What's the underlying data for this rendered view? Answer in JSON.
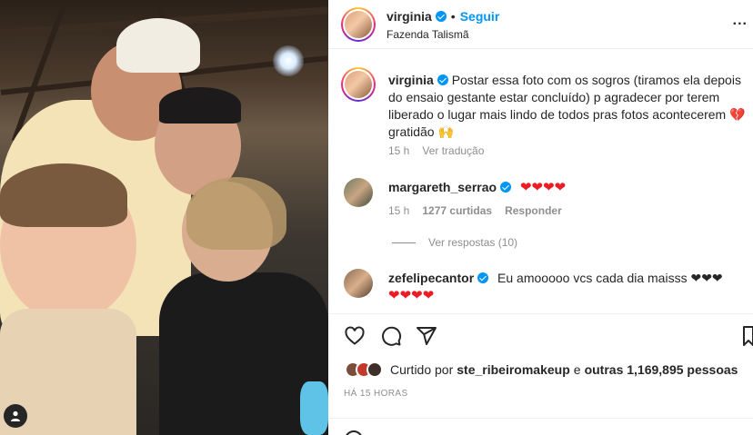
{
  "post": {
    "username": "virginia",
    "follow_label": "Seguir",
    "dot": "•",
    "location": "Fazenda Talismã",
    "more": "..."
  },
  "caption": {
    "username": "virginia",
    "text": "Postar essa foto com os sogros (tiramos ela depois do ensaio gestante estar concluído) p agradecer por terem liberado o lugar mais lindo de todos pras fotos acontecerem 💔 gratidão 🙌",
    "time": "15 h",
    "translate_label": "Ver tradução"
  },
  "comments": [
    {
      "username": "margareth_serrao",
      "text": "❤❤❤❤",
      "time": "15 h",
      "likes": "1277 curtidas",
      "reply_label": "Responder"
    },
    {
      "username": "zefelipecantor",
      "text": "Eu amooooo vcs cada dia maisss ❤❤❤",
      "text2": "❤❤❤❤"
    }
  ],
  "replies_label": "Ver respostas (10)",
  "likes": {
    "prefix": "Curtido por",
    "user": "ste_ribeiromakeup",
    "middle": "e",
    "rest": "outras 1,169,895 pessoas"
  },
  "timestamp": "HÁ 15 HORAS",
  "icons": [
    "heart-icon",
    "comment-icon",
    "share-icon",
    "bookmark-icon",
    "user-tag-icon",
    "verified-icon"
  ],
  "colors": {
    "accent": "#0095f6",
    "heart": "#ed1c24",
    "muted": "#8e8e8e"
  }
}
